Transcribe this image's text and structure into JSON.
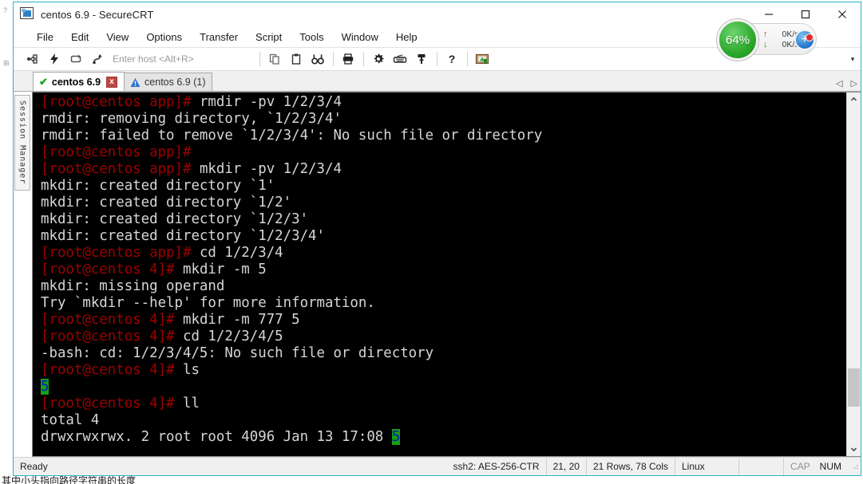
{
  "window": {
    "title": "centos 6.9 - SecureCRT",
    "app_icon": "terminal-app-icon",
    "minimize": "—",
    "maximize": "□",
    "close": "✕"
  },
  "menu": {
    "items": [
      {
        "label": "File"
      },
      {
        "label": "Edit"
      },
      {
        "label": "View"
      },
      {
        "label": "Options"
      },
      {
        "label": "Transfer"
      },
      {
        "label": "Script"
      },
      {
        "label": "Tools"
      },
      {
        "label": "Window"
      },
      {
        "label": "Help"
      }
    ]
  },
  "toolbar": {
    "host_placeholder": "Enter host <Alt+R>",
    "buttons": [
      {
        "name": "connect-icon",
        "title": "Connect"
      },
      {
        "name": "quick-connect-icon",
        "title": "Quick Connect"
      },
      {
        "name": "reconnect-icon",
        "title": "Reconnect"
      },
      {
        "name": "disconnect-icon",
        "title": "Disconnect"
      },
      {
        "name": "copy-icon",
        "title": "Copy"
      },
      {
        "name": "paste-icon",
        "title": "Paste"
      },
      {
        "name": "find-icon",
        "title": "Find"
      },
      {
        "name": "print-icon",
        "title": "Print"
      },
      {
        "name": "settings-gear-icon",
        "title": "Session Options"
      },
      {
        "name": "keyboard-icon",
        "title": "Keymap Editor"
      },
      {
        "name": "key-icon",
        "title": "Public Key"
      },
      {
        "name": "help-icon",
        "title": "Help"
      },
      {
        "name": "session-options-icon",
        "title": "Session Options"
      }
    ],
    "overflow_chevron": "▾"
  },
  "speed_widget": {
    "gauge_percent": "64%",
    "upload_speed": "0K/s",
    "download_speed": "0K/s",
    "upload_arrow": "↑",
    "download_arrow": "↓",
    "add_button": "+"
  },
  "sidebar": {
    "session_manager_label": "Session Manager"
  },
  "tabs": {
    "items": [
      {
        "label": "centos 6.9",
        "active": true,
        "status_icon": "check-icon",
        "close_label": "x"
      },
      {
        "label": "centos 6.9 (1)",
        "active": false,
        "status_icon": "warning-icon"
      }
    ],
    "nav_prev": "◁",
    "nav_next": "▷"
  },
  "terminal": {
    "lines": [
      {
        "segments": [
          {
            "text": "[root@centos app]#",
            "style": "prompt"
          },
          {
            "text": " rmdir -pv 1/2/3/4",
            "style": "white"
          }
        ]
      },
      {
        "segments": [
          {
            "text": "rmdir: removing directory, `1/2/3/4'",
            "style": "white"
          }
        ]
      },
      {
        "segments": [
          {
            "text": "rmdir: failed to remove `1/2/3/4': No such file or directory",
            "style": "white"
          }
        ]
      },
      {
        "segments": [
          {
            "text": "[root@centos app]#",
            "style": "prompt"
          }
        ]
      },
      {
        "segments": [
          {
            "text": "[root@centos app]#",
            "style": "prompt"
          },
          {
            "text": " mkdir -pv 1/2/3/4",
            "style": "white"
          }
        ]
      },
      {
        "segments": [
          {
            "text": "mkdir: created directory `1'",
            "style": "white"
          }
        ]
      },
      {
        "segments": [
          {
            "text": "mkdir: created directory `1/2'",
            "style": "white"
          }
        ]
      },
      {
        "segments": [
          {
            "text": "mkdir: created directory `1/2/3'",
            "style": "white"
          }
        ]
      },
      {
        "segments": [
          {
            "text": "mkdir: created directory `1/2/3/4'",
            "style": "white"
          }
        ]
      },
      {
        "segments": [
          {
            "text": "[root@centos app]#",
            "style": "prompt"
          },
          {
            "text": " cd 1/2/3/4",
            "style": "white"
          }
        ]
      },
      {
        "segments": [
          {
            "text": "[root@centos 4]#",
            "style": "prompt"
          },
          {
            "text": " mkdir -m 5",
            "style": "white"
          }
        ]
      },
      {
        "segments": [
          {
            "text": "mkdir: missing operand",
            "style": "white"
          }
        ]
      },
      {
        "segments": [
          {
            "text": "Try `mkdir --help' for more information.",
            "style": "white"
          }
        ]
      },
      {
        "segments": [
          {
            "text": "[root@centos 4]#",
            "style": "prompt"
          },
          {
            "text": " mkdir -m 777 5",
            "style": "white"
          }
        ]
      },
      {
        "segments": [
          {
            "text": "[root@centos 4]#",
            "style": "prompt"
          },
          {
            "text": " cd 1/2/3/4/5",
            "style": "white"
          }
        ]
      },
      {
        "segments": [
          {
            "text": "-bash: cd: 1/2/3/4/5: No such file or directory",
            "style": "white"
          }
        ]
      },
      {
        "segments": [
          {
            "text": "[root@centos 4]#",
            "style": "prompt"
          },
          {
            "text": " ls",
            "style": "white"
          }
        ]
      },
      {
        "segments": [
          {
            "text": "5",
            "style": "dir"
          }
        ]
      },
      {
        "segments": [
          {
            "text": "[root@centos 4]#",
            "style": "prompt"
          },
          {
            "text": " ll",
            "style": "white"
          }
        ]
      },
      {
        "segments": [
          {
            "text": "total 4",
            "style": "white"
          }
        ]
      },
      {
        "segments": [
          {
            "text": "drwxrwxrwx. 2 root root 4096 Jan 13 17:08 ",
            "style": "white"
          },
          {
            "text": "5",
            "style": "dir"
          }
        ]
      }
    ]
  },
  "statusbar": {
    "ready": "Ready",
    "protocol": "ssh2: AES-256-CTR",
    "cursor_position": "21, 20",
    "dimensions": "21 Rows, 78 Cols",
    "platform": "Linux",
    "caps_lock": "CAP",
    "num_lock": "NUM"
  },
  "background": {
    "doc_text": "其中小头指向路径字符串的长度"
  },
  "colors": {
    "window_border": "#2ab4c8",
    "terminal_bg": "#000000",
    "prompt_red": "#9e0000",
    "terminal_fg": "#d6d6d6",
    "dir_green_bg": "#14a014",
    "dir_blue_fg": "#0a19b8",
    "gauge_green": "#2aa82a",
    "add_button_blue": "#2b7fd0"
  }
}
